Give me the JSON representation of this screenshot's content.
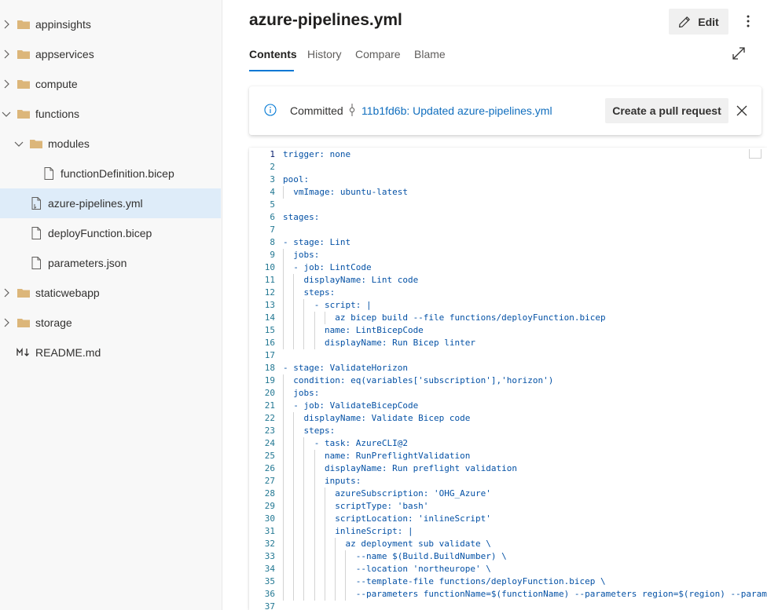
{
  "sidebar": {
    "items": [
      {
        "label": "appinsights",
        "type": "folder",
        "expanded": false
      },
      {
        "label": "appservices",
        "type": "folder",
        "expanded": false
      },
      {
        "label": "compute",
        "type": "folder",
        "expanded": false
      },
      {
        "label": "functions",
        "type": "folder",
        "expanded": true
      },
      {
        "label": "modules",
        "type": "folder",
        "expanded": true
      },
      {
        "label": "functionDefinition.bicep",
        "type": "file"
      },
      {
        "label": "azure-pipelines.yml",
        "type": "file",
        "selected": true
      },
      {
        "label": "deployFunction.bicep",
        "type": "file"
      },
      {
        "label": "parameters.json",
        "type": "file"
      },
      {
        "label": "staticwebapp",
        "type": "folder",
        "expanded": false
      },
      {
        "label": "storage",
        "type": "folder",
        "expanded": false
      },
      {
        "label": "README.md",
        "type": "markdown"
      }
    ]
  },
  "header": {
    "file_title": "azure-pipelines.yml",
    "edit_label": "Edit",
    "more_icon": "more-vertical-icon",
    "expand_icon": "expand-icon"
  },
  "tabs": [
    {
      "label": "Contents",
      "active": true
    },
    {
      "label": "History"
    },
    {
      "label": "Compare"
    },
    {
      "label": "Blame"
    }
  ],
  "commit_banner": {
    "committed_label": "Committed",
    "commit_link": "11b1fd6b: Updated azure-pipelines.yml",
    "pr_button": "Create a pull request",
    "info_icon": "info-icon",
    "close_icon": "close-icon"
  },
  "code": {
    "current_line": 1,
    "lines": [
      "trigger: none",
      "",
      "pool:",
      "  vmImage: ubuntu-latest",
      "",
      "stages:",
      "",
      "- stage: Lint",
      "  jobs:",
      "  - job: LintCode",
      "    displayName: Lint code",
      "    steps:",
      "      - script: |",
      "          az bicep build --file functions/deployFunction.bicep",
      "        name: LintBicepCode",
      "        displayName: Run Bicep linter",
      "",
      "- stage: ValidateHorizon",
      "  condition: eq(variables['subscription'],'horizon')",
      "  jobs:",
      "  - job: ValidateBicepCode",
      "    displayName: Validate Bicep code",
      "    steps:",
      "      - task: AzureCLI@2",
      "        name: RunPreflightValidation",
      "        displayName: Run preflight validation",
      "        inputs:",
      "          azureSubscription: 'OHG_Azure'",
      "          scriptType: 'bash'",
      "          scriptLocation: 'inlineScript'",
      "          inlineScript: |",
      "            az deployment sub validate \\",
      "              --name $(Build.BuildNumber) \\",
      "              --location 'northeurope' \\",
      "              --template-file functions/deployFunction.bicep \\",
      "              --parameters functionName=$(functionName) --parameters region=$(region) --parameters",
      ""
    ]
  },
  "colors": {
    "accent": "#0078d4",
    "link": "#106ebe",
    "selected_row": "#deecf9",
    "folder": "#dcb67a",
    "code_text": "#0451a5",
    "line_number": "#237893"
  }
}
